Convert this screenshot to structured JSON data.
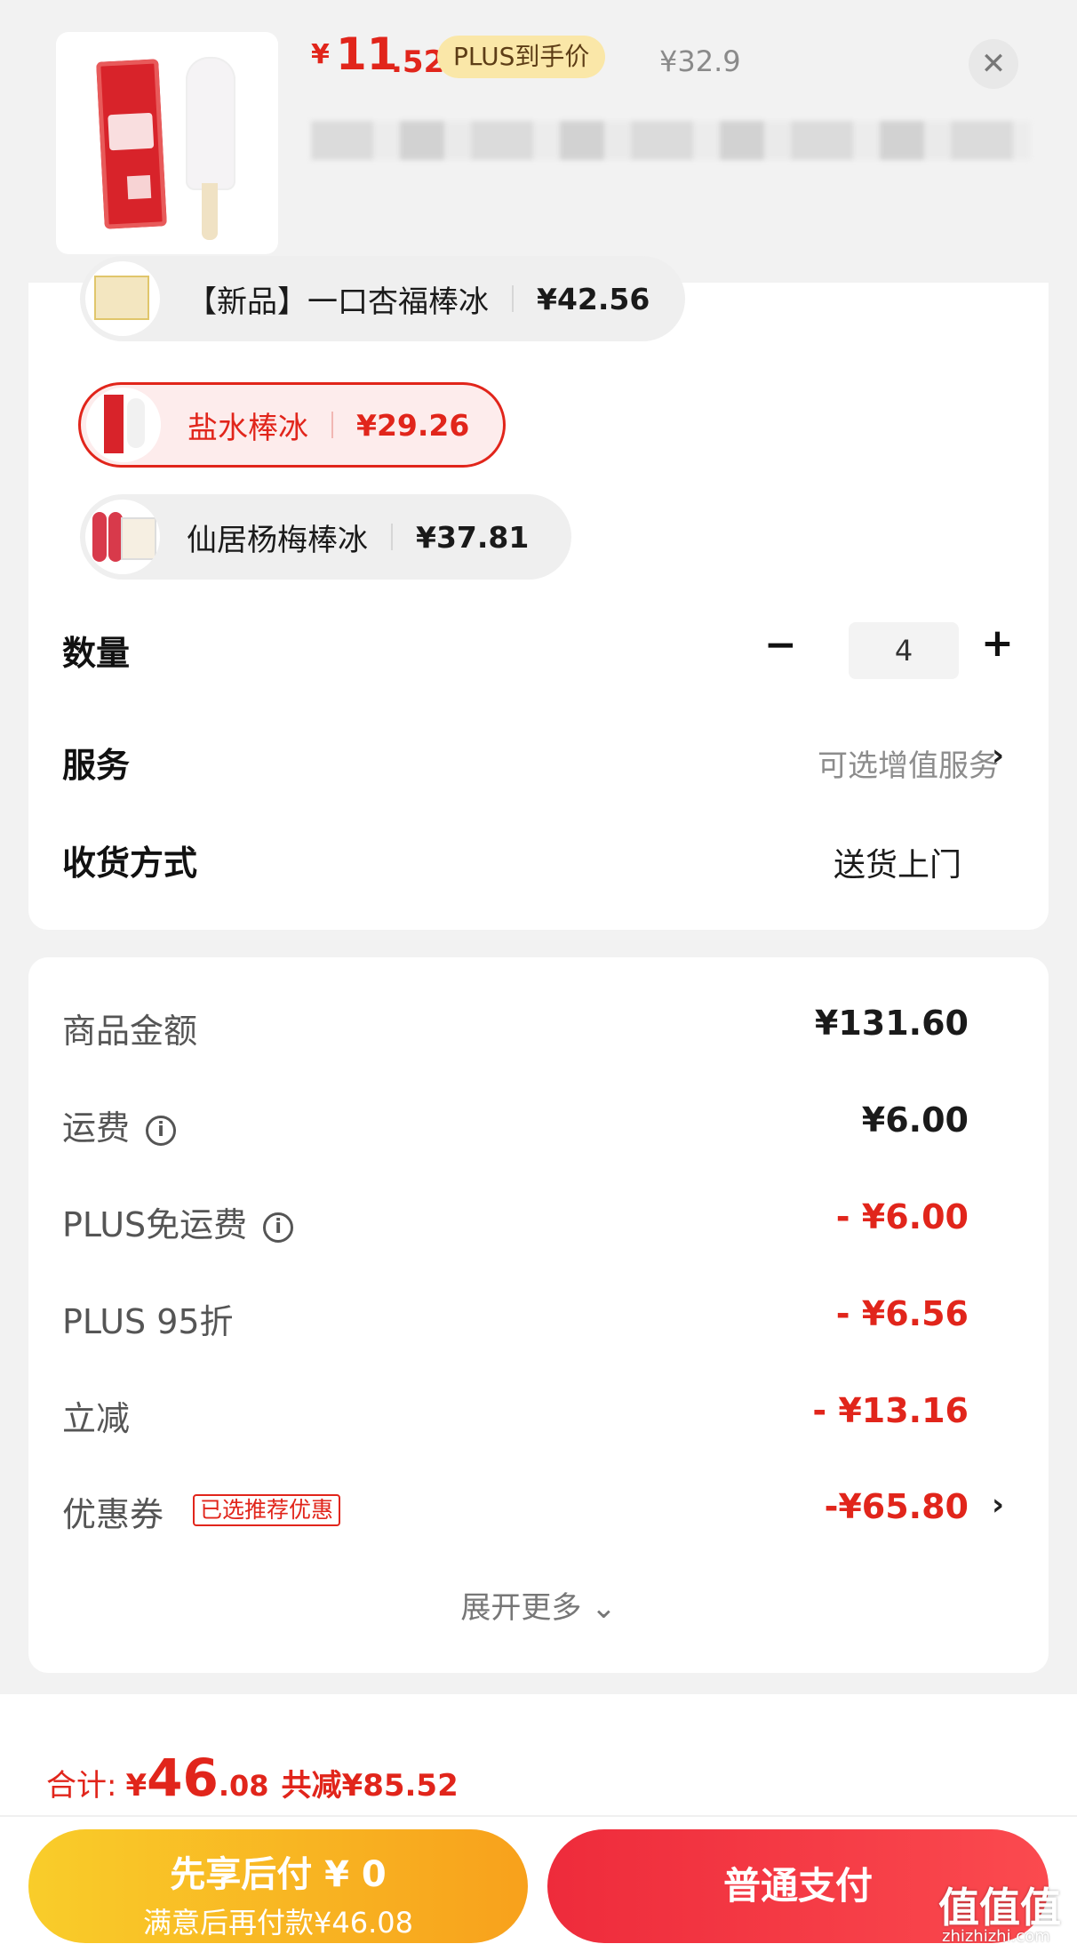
{
  "header": {
    "price_currency": "¥",
    "price_integer": "11",
    "price_decimal": ".52",
    "plus_badge": "PLUS到手价",
    "original_price": "¥32.9",
    "close_icon": "close-icon"
  },
  "variants": [
    {
      "name": "【新品】一口杏福棒冰",
      "price": "¥42.56",
      "selected": false
    },
    {
      "name": "盐水棒冰",
      "price": "¥29.26",
      "selected": true
    },
    {
      "name": "仙居杨梅棒冰",
      "price": "¥37.81",
      "selected": false
    }
  ],
  "quantity": {
    "label": "数量",
    "minus": "−",
    "value": "4",
    "plus": "+"
  },
  "service": {
    "label": "服务",
    "value": "可选增值服务",
    "chevron": "›"
  },
  "delivery": {
    "label": "收货方式",
    "value": "送货上门"
  },
  "fees": {
    "goods": {
      "label": "商品金额",
      "value": "¥131.60"
    },
    "shipping": {
      "label": "运费",
      "value": "¥6.00"
    },
    "plus_free_shipping": {
      "label": "PLUS免运费",
      "value": "- ¥6.00"
    },
    "plus_discount": {
      "label": "PLUS 95折",
      "value": "- ¥6.56"
    },
    "instant_cut": {
      "label": "立减",
      "value": "- ¥13.16"
    },
    "coupon": {
      "label": "优惠券",
      "tag": "已选推荐优惠",
      "value": "-¥65.80",
      "chevron": "›"
    },
    "expand": "展开更多 ⌄",
    "info_glyph": "i"
  },
  "summary": {
    "total_label": "合计:",
    "total_currency": "¥",
    "total_integer": "46",
    "total_decimal": ".08",
    "saved": "共减¥85.52"
  },
  "buttons": {
    "bnpl_line1": "先享后付 ¥ 0",
    "bnpl_line2": "满意后再付款¥46.08",
    "pay": "普通支付"
  },
  "watermark": {
    "text": "值值值",
    "sub": "zhizhizhi.com"
  },
  "colors": {
    "accent": "#e1251b",
    "pay_button": "#f0323f",
    "bnpl_button": "#f9b923",
    "plus_badge_bg": "#fae7a8"
  }
}
